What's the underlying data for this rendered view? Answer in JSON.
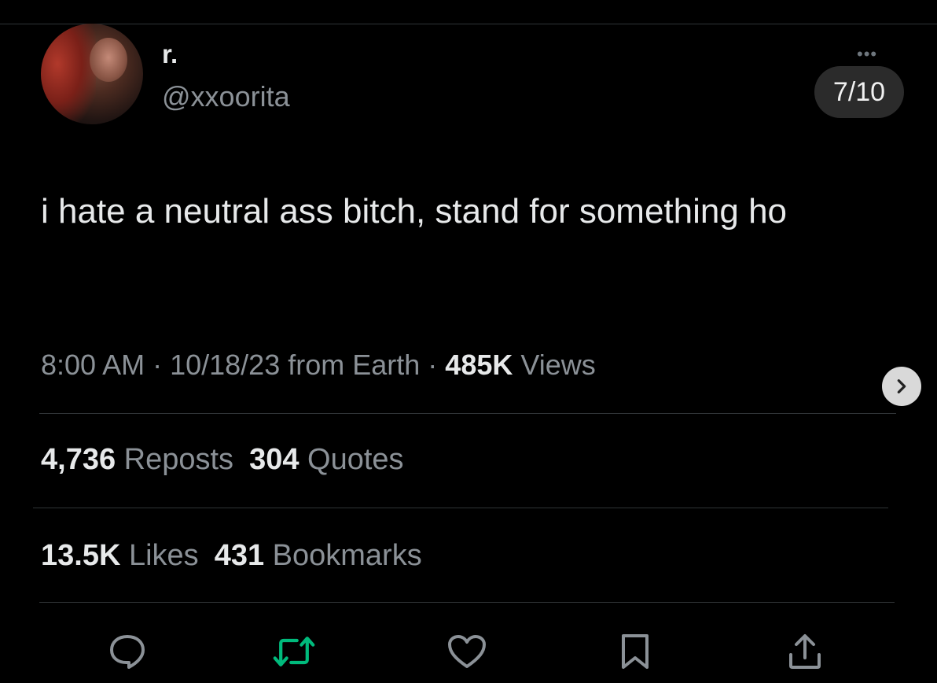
{
  "user": {
    "display_name": "r.",
    "handle": "@xxoorita"
  },
  "carousel": {
    "counter": "7/10"
  },
  "tweet": {
    "text": "i hate a neutral ass bitch, stand for something ho",
    "time": "8:00 AM",
    "date": "10/18/23",
    "source": "from Earth",
    "views_count": "485K",
    "views_label": "Views"
  },
  "stats": {
    "reposts_count": "4,736",
    "reposts_label": "Reposts",
    "quotes_count": "304",
    "quotes_label": "Quotes",
    "likes_count": "13.5K",
    "likes_label": "Likes",
    "bookmarks_count": "431",
    "bookmarks_label": "Bookmarks"
  },
  "icons": {
    "reply": "reply-icon",
    "repost": "repost-icon",
    "like": "heart-icon",
    "bookmark": "bookmark-icon",
    "share": "share-icon",
    "more": "more-icon",
    "next": "chevron-right-icon"
  },
  "colors": {
    "background": "#000000",
    "text_primary": "#e7e9ea",
    "text_secondary": "#8b9197",
    "repost_green": "#00ba7c",
    "divider": "#2f3336"
  }
}
